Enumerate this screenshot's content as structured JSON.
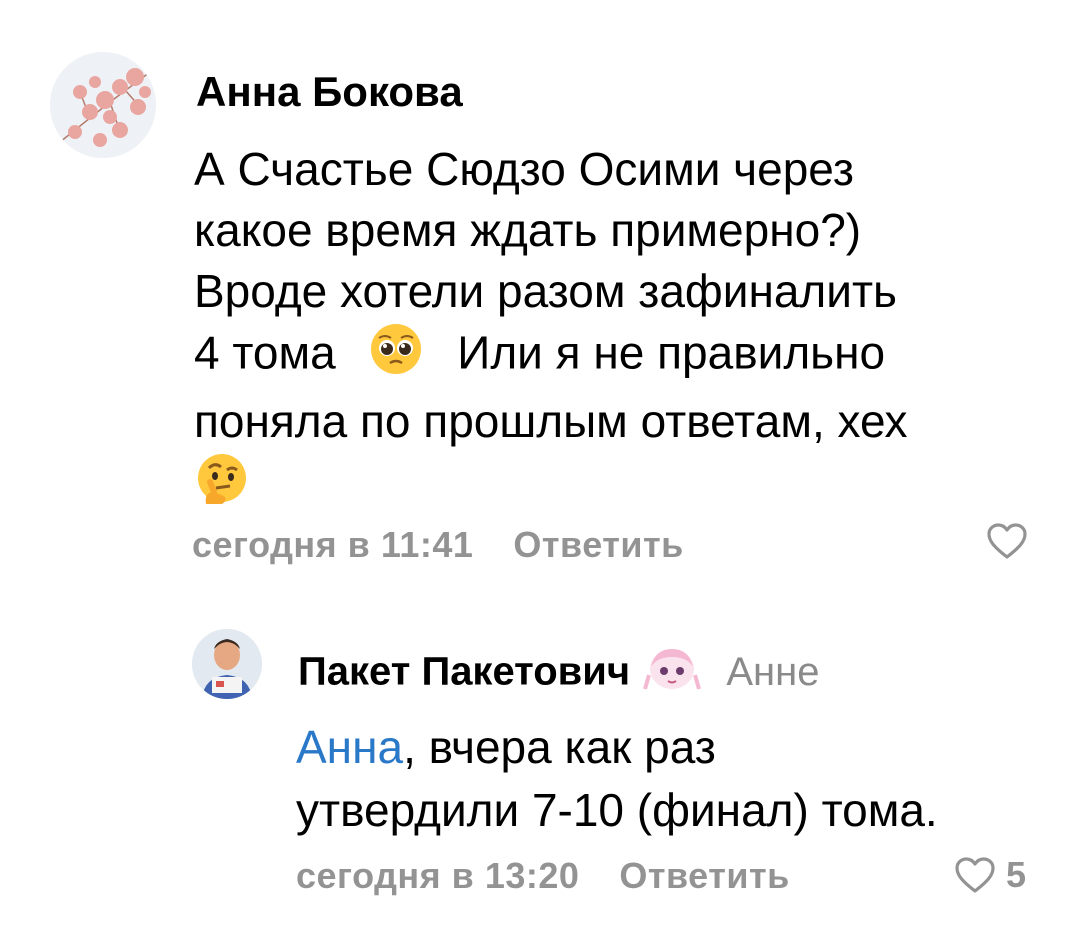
{
  "comments": [
    {
      "author": "Анна Бокова",
      "text_lines": [
        "А Счастье Сюдзо Осими через",
        "какое время ждать примерно?)",
        "Вроде хотели разом зафиналить",
        "4 тома",
        "Или я не правильно",
        "поняла по прошлым ответам, хех"
      ],
      "emojis": [
        "pleading-face-emoji",
        "thinking-face-emoji"
      ],
      "timestamp": "сегодня в 11:41",
      "reply_label": "Ответить",
      "likes": ""
    },
    {
      "author": "Пакет Пакетович",
      "reply_to": "Анне",
      "mention": "Анна",
      "text_after_mention": ", вчера как раз",
      "text_line2": "утвердили 7-10 (финал) тома.",
      "timestamp": "сегодня в 13:20",
      "reply_label": "Ответить",
      "likes": "5"
    }
  ],
  "colors": {
    "meta_gray": "#939393",
    "mention_blue": "#2a79c9",
    "reply_to_gray": "#8a8a8a"
  }
}
